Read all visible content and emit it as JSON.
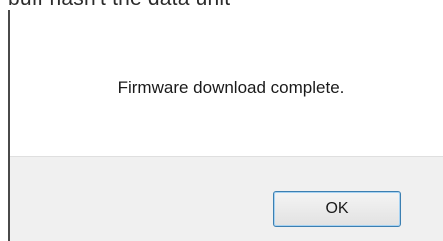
{
  "background_window": {
    "text": "buff hasn't the data unit"
  },
  "dialog": {
    "message": "Firmware download complete.",
    "ok_label": "OK"
  },
  "colors": {
    "footer_background": "#f0f0f0",
    "button_border": "#3c7fb1",
    "button_focus_glow": "#a6d2f2"
  }
}
